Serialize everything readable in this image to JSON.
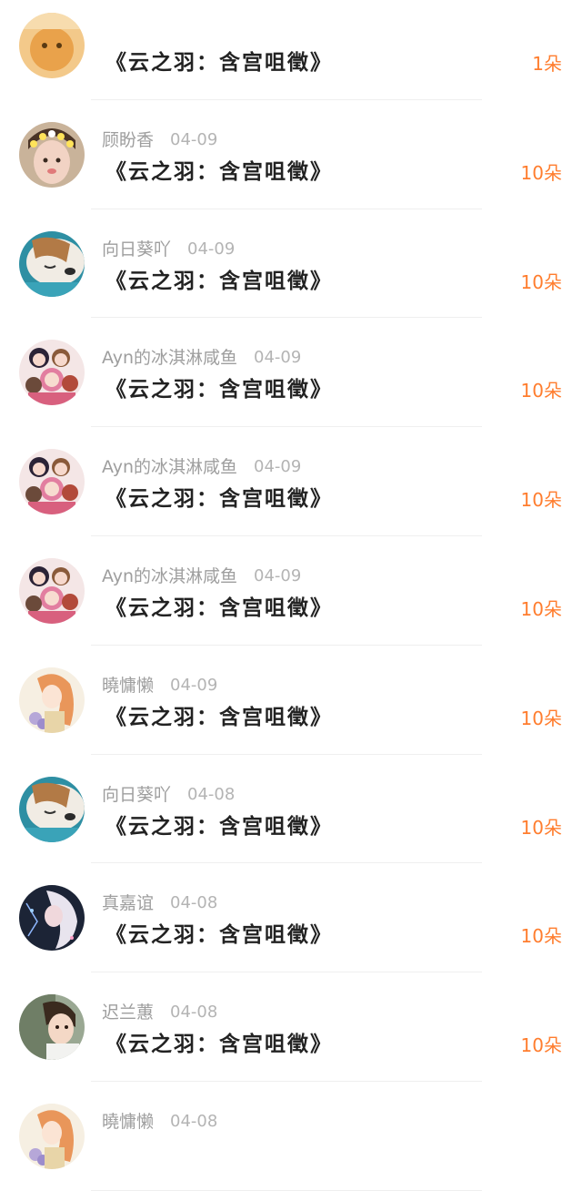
{
  "gift_list": [
    {
      "name": "",
      "date": "",
      "title": "《云之羽：含宫咀徵》",
      "count": "1朵",
      "avatar": "orange-cat-avatar"
    },
    {
      "name": "顾盼香",
      "date": "04-09",
      "title": "《云之羽：含宫咀徵》",
      "count": "10朵",
      "avatar": "flower-crown-girl-avatar"
    },
    {
      "name": "向日葵吖",
      "date": "04-09",
      "title": "《云之羽：含宫咀徵》",
      "count": "10朵",
      "avatar": "sleeping-dog-avatar"
    },
    {
      "name": "Ayn的冰淇淋咸鱼",
      "date": "04-09",
      "title": "《云之羽：含宫咀徵》",
      "count": "10朵",
      "avatar": "anime-girls-avatar"
    },
    {
      "name": "Ayn的冰淇淋咸鱼",
      "date": "04-09",
      "title": "《云之羽：含宫咀徵》",
      "count": "10朵",
      "avatar": "anime-girls-avatar"
    },
    {
      "name": "Ayn的冰淇淋咸鱼",
      "date": "04-09",
      "title": "《云之羽：含宫咀徵》",
      "count": "10朵",
      "avatar": "anime-girls-avatar"
    },
    {
      "name": "曉慵懒",
      "date": "04-09",
      "title": "《云之羽：含宫咀徵》",
      "count": "10朵",
      "avatar": "illustrated-girl-avatar"
    },
    {
      "name": "向日葵吖",
      "date": "04-08",
      "title": "《云之羽：含宫咀徵》",
      "count": "10朵",
      "avatar": "sleeping-dog-avatar"
    },
    {
      "name": "真嘉谊",
      "date": "04-08",
      "title": "《云之羽：含宫咀徵》",
      "count": "10朵",
      "avatar": "dark-fantasy-avatar"
    },
    {
      "name": "迟兰蕙",
      "date": "04-08",
      "title": "《云之羽：含宫咀徵》",
      "count": "10朵",
      "avatar": "child-photo-avatar"
    },
    {
      "name": "曉慵懒",
      "date": "04-08",
      "title": "",
      "count": "",
      "avatar": "illustrated-girl-avatar"
    }
  ],
  "colors": {
    "name_text": "#9e9e9e",
    "date_text": "#b4b4b4",
    "title_text": "#222222",
    "count_accent": "#ff7d2e",
    "divider": "#efefef"
  }
}
